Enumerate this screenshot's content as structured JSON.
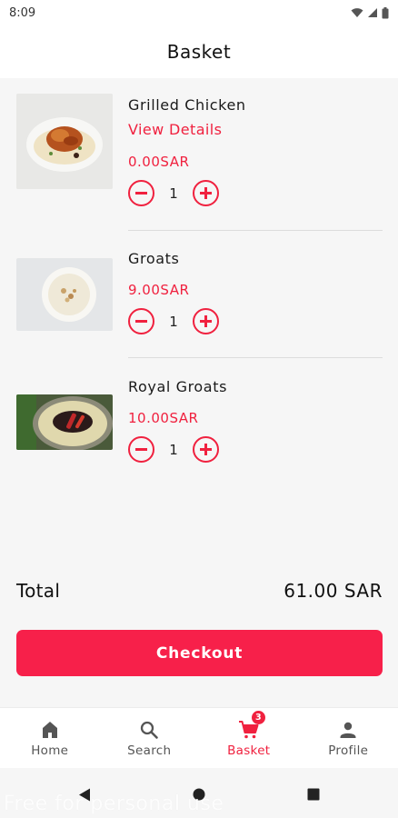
{
  "status_bar": {
    "time": "8:09"
  },
  "header": {
    "title": "Basket"
  },
  "basket": {
    "items": [
      {
        "name": "Grilled Chicken",
        "details_link": "View Details",
        "price": "0.00SAR",
        "quantity": "1"
      },
      {
        "name": "Groats",
        "price": "9.00SAR",
        "quantity": "1"
      },
      {
        "name": "Royal Groats",
        "price": "10.00SAR",
        "quantity": "1"
      }
    ]
  },
  "summary": {
    "total_label": "Total",
    "total_value": "61.00 SAR"
  },
  "checkout": {
    "label": "Checkout"
  },
  "bottom_nav": {
    "items": [
      {
        "label": "Home",
        "icon": "home-icon"
      },
      {
        "label": "Search",
        "icon": "search-icon"
      },
      {
        "label": "Basket",
        "icon": "cart-icon",
        "badge": "3",
        "active": true
      },
      {
        "label": "Profile",
        "icon": "person-icon"
      }
    ]
  },
  "watermark": "Free for personal use",
  "colors": {
    "accent": "#f0213f",
    "checkout_bg": "#f7204a",
    "background": "#f6f6f6"
  }
}
